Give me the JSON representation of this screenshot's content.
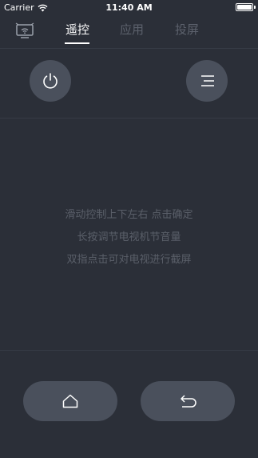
{
  "status_bar": {
    "carrier": "Carrier",
    "time": "11:40 AM",
    "battery_level": 1.0
  },
  "tabs": [
    {
      "label": "遥控",
      "active": true
    },
    {
      "label": "应用",
      "active": false
    },
    {
      "label": "投屏",
      "active": false
    }
  ],
  "icons": {
    "tv": "tv-icon",
    "power": "power-icon",
    "menu": "menu-icon",
    "home": "home-icon",
    "back": "back-icon"
  },
  "hints": [
    "滑动控制上下左右  点击确定",
    "长按调节电视机节音量",
    "双指点击可对电视进行截屏"
  ],
  "colors": {
    "background": "#2b2f38",
    "button": "#4a505c",
    "active_tab": "#ffffff",
    "inactive_tab": "#5c616c",
    "hint_text": "#5a5f69"
  }
}
